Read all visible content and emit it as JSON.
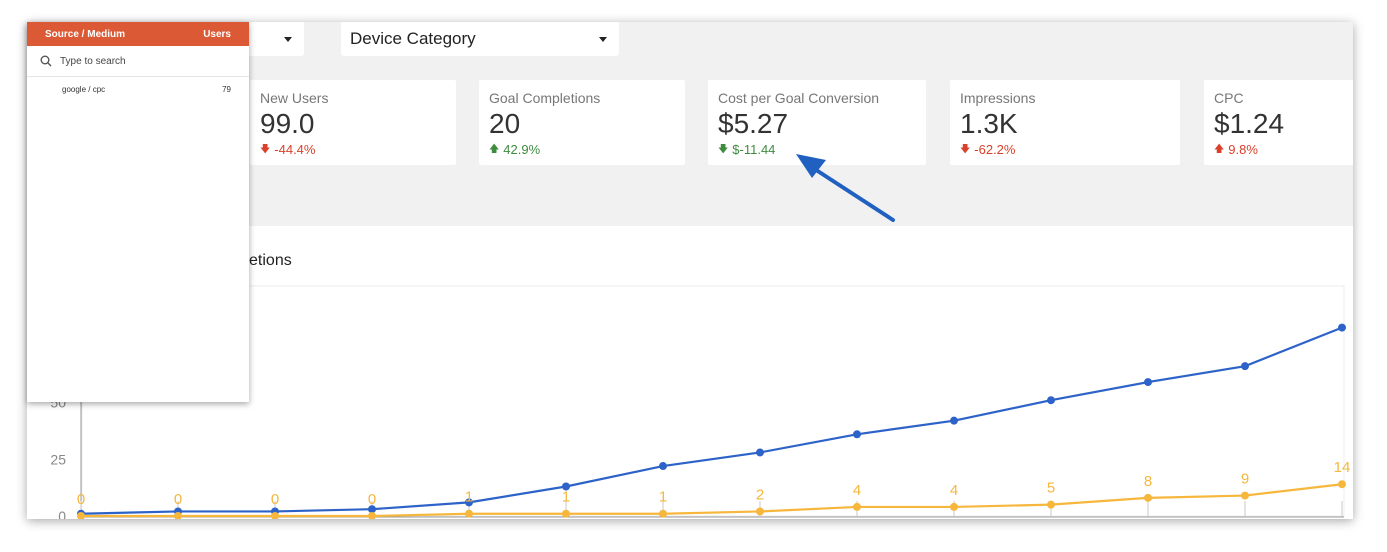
{
  "filters": {
    "first_dropdown": "",
    "device_category": "Device Category"
  },
  "metrics": [
    {
      "label": "New Users",
      "value": "99.0",
      "delta": "-44.4%",
      "direction": "down",
      "color": "#d9412b"
    },
    {
      "label": "Goal Completions",
      "value": "20",
      "delta": "42.9%",
      "direction": "up",
      "color": "#3f8c3f"
    },
    {
      "label": "Cost per Goal Conversion",
      "value": "$5.27",
      "delta": "$-11.44",
      "direction": "down",
      "color": "#3f8c3f"
    },
    {
      "label": "Impressions",
      "value": "1.3K",
      "delta": "-62.2%",
      "direction": "down",
      "color": "#d9412b"
    },
    {
      "label": "CPC",
      "value": "$1.24",
      "delta": "9.8%",
      "direction": "up",
      "color": "#d9412b"
    }
  ],
  "chart_title_visible": "oal Completions",
  "panel": {
    "header_left": "Source / Medium",
    "header_right": "Users",
    "search_placeholder": "Type to search",
    "rows": [
      {
        "name": "google / cpc",
        "users": "79"
      }
    ]
  },
  "chart_data": {
    "type": "line",
    "title": "",
    "y_ticks_visible": [
      "0",
      "25",
      "50"
    ],
    "ylim": [
      0,
      55
    ],
    "series": [
      {
        "color": "#2d63c8",
        "values": [
          1,
          2,
          2,
          3,
          6,
          13,
          22,
          28,
          36,
          42,
          51,
          59,
          66,
          83
        ]
      },
      {
        "color": "#f6b73c",
        "values": [
          0,
          0,
          0,
          0,
          1,
          1,
          1,
          2,
          4,
          4,
          5,
          8,
          9,
          14
        ]
      }
    ],
    "data_labels": [
      "0",
      "0",
      "0",
      "0",
      "1",
      "1",
      "1",
      "2",
      "4",
      "4",
      "5",
      "8",
      "9",
      "14"
    ],
    "grid": false
  },
  "colors": {
    "panel_header": "#db5a35",
    "annotation_arrow": "#2060c0"
  }
}
